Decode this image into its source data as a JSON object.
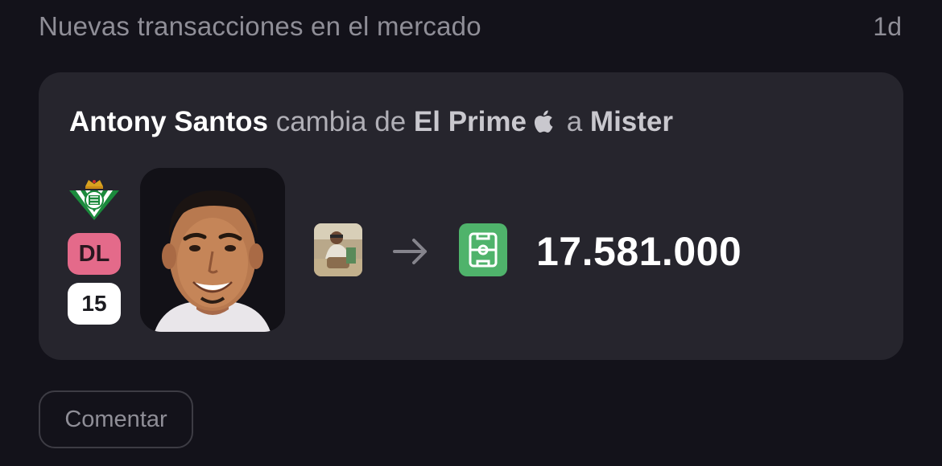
{
  "feed": {
    "title": "Nuevas transacciones en el mercado",
    "time_ago": "1d"
  },
  "transaction": {
    "player_name": "Antony Santos",
    "verb": "cambia de",
    "from_team": "El Prime",
    "connector": "a",
    "to_team": "Mister",
    "position": "DL",
    "number": "15",
    "amount": "17.581.000",
    "colors": {
      "position_badge": "#e46a8a",
      "to_icon": "#4fb36b",
      "card": "#26252d"
    },
    "icons": {
      "from_team_icon": "apple-icon",
      "club_crest": "real-betis-crest",
      "transfer_arrow": "arrow-right-icon",
      "to_team_icon": "football-pitch-icon"
    }
  },
  "actions": {
    "comment_label": "Comentar"
  }
}
